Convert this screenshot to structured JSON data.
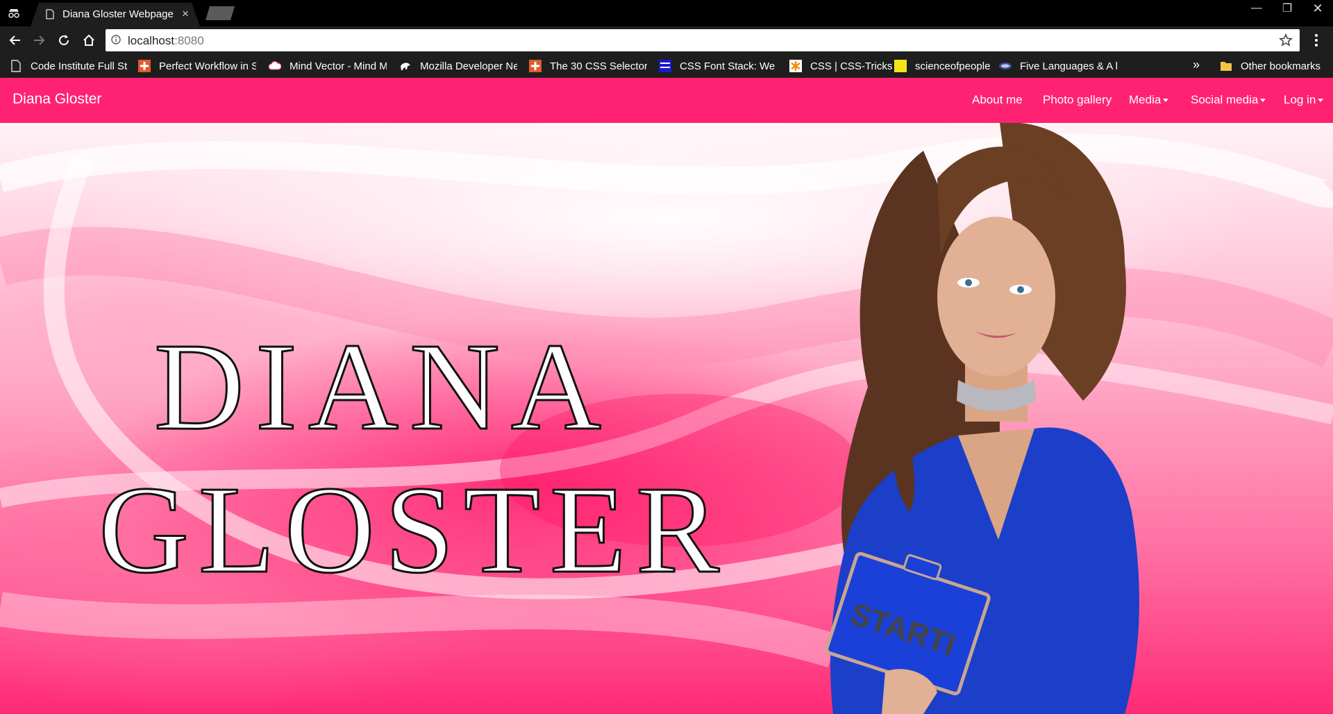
{
  "browser": {
    "tab_title": "Diana Gloster Webpage",
    "tab_close": "×",
    "url_host": "localhost",
    "url_port": ":8080",
    "window_controls": {
      "minimize": "—",
      "restore": "❐",
      "close": "✕"
    }
  },
  "bookmarks": {
    "items": [
      {
        "label": "Code Institute Full St",
        "icon": "page-icon"
      },
      {
        "label": "Perfect Workflow in S",
        "icon": "plus-cross-icon"
      },
      {
        "label": "Mind Vector - Mind M",
        "icon": "cloud-icon"
      },
      {
        "label": "Mozilla Developer Ne",
        "icon": "dinosaur-icon"
      },
      {
        "label": "The 30 CSS Selectors",
        "icon": "plus-cross-icon"
      },
      {
        "label": "CSS Font Stack: Web",
        "icon": "fonts-icon"
      },
      {
        "label": "CSS | CSS-Tricks",
        "icon": "asterisk-icon"
      },
      {
        "label": "scienceofpeople",
        "icon": "yellow-square-icon"
      },
      {
        "label": "Five Languages & A l",
        "icon": "flag-icon"
      }
    ],
    "more": "»",
    "other": "Other bookmarks"
  },
  "site": {
    "brand": "Diana Gloster",
    "nav": {
      "about": "About me",
      "gallery": "Photo gallery",
      "media": "Media",
      "social": "Social media",
      "login": "Log in"
    },
    "hero_line1": "DIANA",
    "hero_line2": "GLOSTER",
    "box_text": "STARTI"
  },
  "colors": {
    "navbar": "#ff2272",
    "hero_pink": "#ff2a76",
    "dress": "#1b3fc8"
  }
}
